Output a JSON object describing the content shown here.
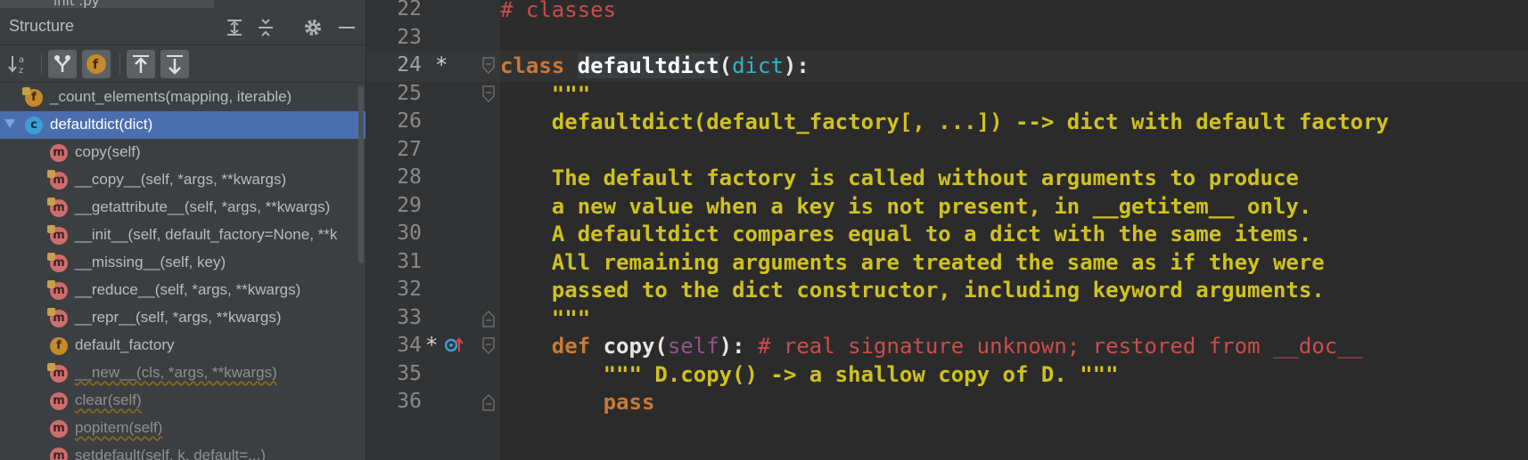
{
  "panel": {
    "file_tab_peek": "init .py",
    "title": "Structure",
    "header_icons": [
      "expand-all-icon",
      "collapse-all-icon",
      "gear-icon",
      "minimize-icon"
    ],
    "toolbar_icons": [
      "sort-alpha-icon",
      "show-inherited-icon",
      "show-fields-icon",
      "navigate-up-icon",
      "navigate-down-icon"
    ]
  },
  "tree": [
    {
      "label": "_count_elements(mapping, iterable)",
      "badge": "f",
      "indent": 1,
      "lock": true,
      "selected": false,
      "inherited": false
    },
    {
      "label": "defaultdict(dict)",
      "badge": "c",
      "indent": 1,
      "lock": false,
      "selected": true,
      "inherited": false,
      "expanded": true
    },
    {
      "label": "copy(self)",
      "badge": "m",
      "indent": 2,
      "lock": false,
      "selected": false,
      "inherited": false
    },
    {
      "label": "__copy__(self, *args, **kwargs)",
      "badge": "m",
      "indent": 2,
      "lock": true,
      "selected": false,
      "inherited": false
    },
    {
      "label": "__getattribute__(self, *args, **kwargs)",
      "badge": "m",
      "indent": 2,
      "lock": true,
      "selected": false,
      "inherited": false
    },
    {
      "label": "__init__(self, default_factory=None, **k",
      "badge": "m",
      "indent": 2,
      "lock": true,
      "selected": false,
      "inherited": false
    },
    {
      "label": "__missing__(self, key)",
      "badge": "m",
      "indent": 2,
      "lock": true,
      "selected": false,
      "inherited": false
    },
    {
      "label": "__reduce__(self, *args, **kwargs)",
      "badge": "m",
      "indent": 2,
      "lock": true,
      "selected": false,
      "inherited": false
    },
    {
      "label": "__repr__(self, *args, **kwargs)",
      "badge": "m",
      "indent": 2,
      "lock": true,
      "selected": false,
      "inherited": false
    },
    {
      "label": "default_factory",
      "badge": "f",
      "indent": 2,
      "lock": false,
      "selected": false,
      "inherited": false
    },
    {
      "label": "__new__(cls, *args, **kwargs)",
      "badge": "m",
      "indent": 2,
      "lock": true,
      "selected": false,
      "inherited": true
    },
    {
      "label": "clear(self)",
      "badge": "m",
      "indent": 2,
      "lock": false,
      "selected": false,
      "inherited": true
    },
    {
      "label": "popitem(self)",
      "badge": "m",
      "indent": 2,
      "lock": false,
      "selected": false,
      "inherited": true
    },
    {
      "label": "setdefault(self, k, default=...)",
      "badge": "m",
      "indent": 2,
      "lock": false,
      "selected": false,
      "inherited": true
    }
  ],
  "editor": {
    "caret_line": 24,
    "lines": [
      {
        "n": "22",
        "segments": [
          {
            "t": "# classes",
            "c": "cm"
          }
        ]
      },
      {
        "n": "23",
        "segments": []
      },
      {
        "n": "24",
        "marker": "*",
        "segments": [
          {
            "t": "class ",
            "c": "kw"
          },
          {
            "t": "defaultdict",
            "c": "cls"
          },
          {
            "t": "(",
            "c": "punc"
          },
          {
            "t": "dict",
            "c": "bi"
          },
          {
            "t": "):",
            "c": "punc"
          }
        ]
      },
      {
        "n": "25",
        "segments": [
          {
            "t": "    \"\"\"",
            "c": "doc"
          }
        ]
      },
      {
        "n": "26",
        "segments": [
          {
            "t": "    defaultdict(default_factory[, ...]) --> dict with default factory",
            "c": "doc"
          }
        ]
      },
      {
        "n": "27",
        "segments": []
      },
      {
        "n": "28",
        "segments": [
          {
            "t": "    The default factory is called without arguments to produce",
            "c": "doc"
          }
        ]
      },
      {
        "n": "29",
        "segments": [
          {
            "t": "    a new value when a key is not present, in __getitem__ only.",
            "c": "doc"
          }
        ]
      },
      {
        "n": "30",
        "segments": [
          {
            "t": "    A defaultdict compares equal to a dict with the same items.",
            "c": "doc"
          }
        ]
      },
      {
        "n": "31",
        "segments": [
          {
            "t": "    All remaining arguments are treated the same as if they were",
            "c": "doc"
          }
        ]
      },
      {
        "n": "32",
        "segments": [
          {
            "t": "    passed to the dict constructor, including keyword arguments.",
            "c": "doc"
          }
        ]
      },
      {
        "n": "33",
        "segments": [
          {
            "t": "    \"\"\"",
            "c": "doc"
          }
        ]
      },
      {
        "n": "34",
        "marker": "*",
        "impl": true,
        "segments": [
          {
            "t": "    def ",
            "c": "kw"
          },
          {
            "t": "copy",
            "c": "white"
          },
          {
            "t": "(",
            "c": "punc"
          },
          {
            "t": "self",
            "c": "self"
          },
          {
            "t": "): ",
            "c": "punc"
          },
          {
            "t": "# real signature unknown; restored from __doc__",
            "c": "cm"
          }
        ]
      },
      {
        "n": "35",
        "segments": [
          {
            "t": "        \"\"\" D.copy() -> a shallow copy of D. \"\"\"",
            "c": "doc"
          }
        ]
      },
      {
        "n": "36",
        "segments": [
          {
            "t": "        pass",
            "c": "kw"
          }
        ]
      }
    ],
    "fold_lines": [
      "24",
      "25",
      "33",
      "34",
      "36"
    ],
    "colors": {
      "background": "#2b2b2b",
      "keyword": "#cc7832",
      "docstring": "#d0c21e",
      "comment": "#cf4b4b",
      "builtin": "#2fb5c9",
      "selection": "#4b6eaf"
    }
  }
}
